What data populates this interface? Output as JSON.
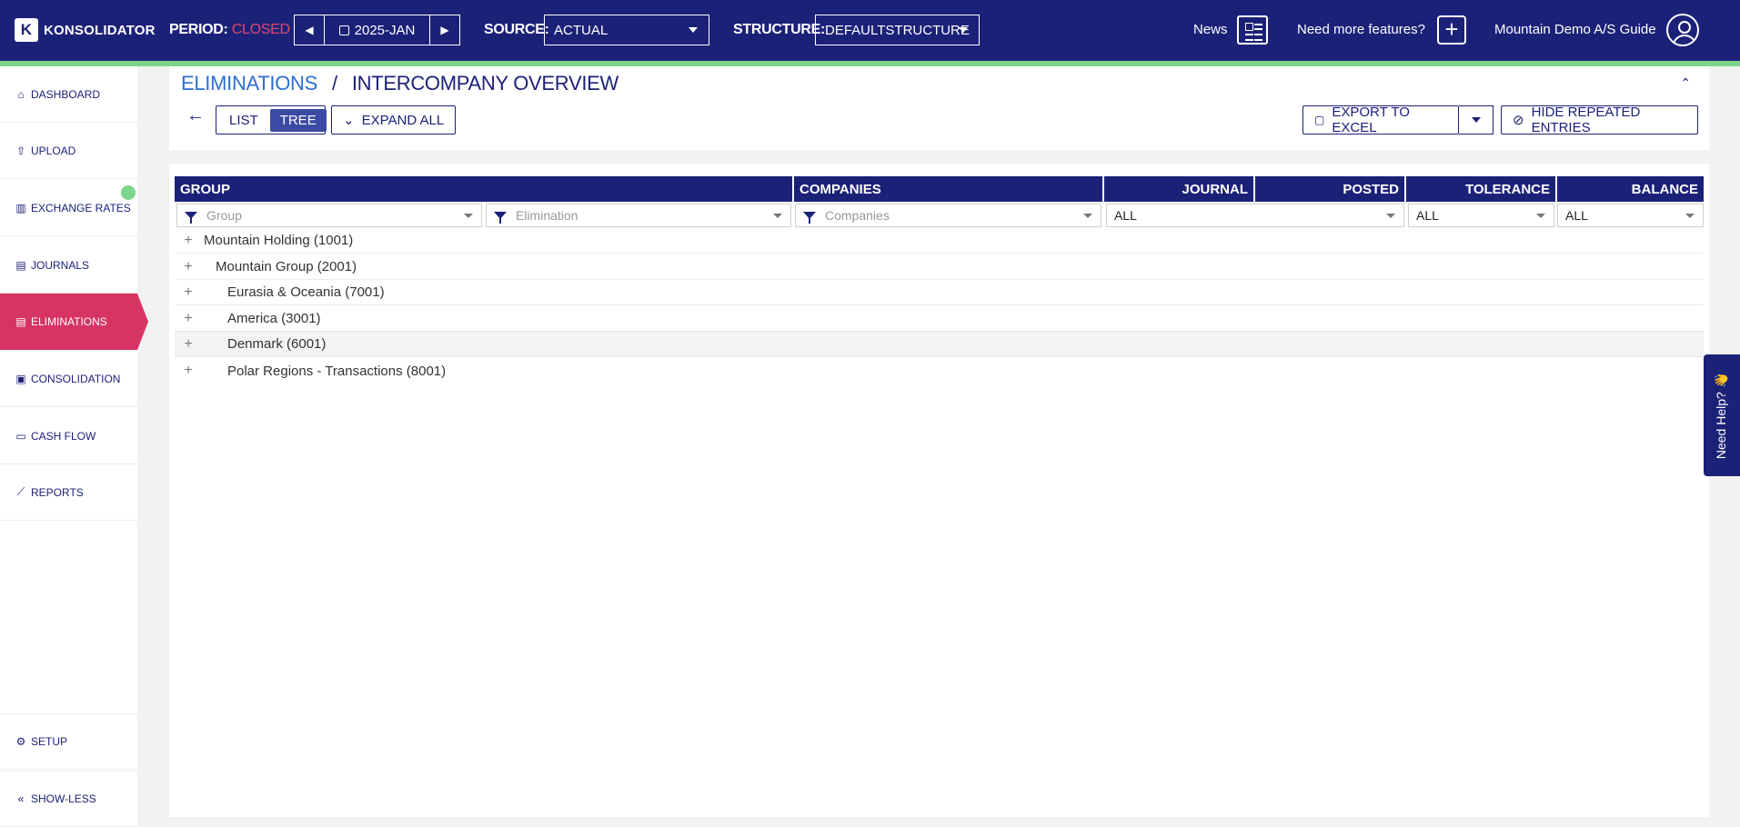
{
  "topbar": {
    "brand": "KONSOLIDATOR",
    "period_label": "PERIOD:",
    "period_status": "CLOSED",
    "period_value": "2025-JAN",
    "source_label": "SOURCE:",
    "source_value": "ACTUAL",
    "structure_label": "STRUCTURE:",
    "structure_value": "DEFAULTSTRUCTURE",
    "news": "News",
    "features": "Need more features?",
    "user": "Mountain Demo A/S Guide"
  },
  "sidebar": {
    "items": [
      {
        "label": "DASHBOARD",
        "icon": "home-icon"
      },
      {
        "label": "UPLOAD",
        "icon": "upload-icon"
      },
      {
        "label": "EXCHANGE RATES",
        "icon": "bar-chart-icon"
      },
      {
        "label": "JOURNALS",
        "icon": "journal-icon"
      },
      {
        "label": "ELIMINATIONS",
        "icon": "eliminations-icon"
      },
      {
        "label": "CONSOLIDATION",
        "icon": "consolidation-icon"
      },
      {
        "label": "CASH FLOW",
        "icon": "cash-icon"
      },
      {
        "label": "REPORTS",
        "icon": "line-chart-icon"
      }
    ],
    "setup": "SETUP",
    "show_less": "SHOW-LESS"
  },
  "header": {
    "breadcrumb_parent": "ELIMINATIONS",
    "breadcrumb_sep": "/",
    "breadcrumb_current": "INTERCOMPANY OVERVIEW",
    "view_list": "LIST",
    "view_tree": "TREE",
    "expand_all": "EXPAND ALL",
    "export": "EXPORT TO EXCEL",
    "hide_repeated": "HIDE REPEATED ENTRIES"
  },
  "grid": {
    "columns": [
      "GROUP",
      "COMPANIES",
      "JOURNAL",
      "POSTED",
      "TOLERANCE",
      "BALANCE"
    ],
    "filters": {
      "group_placeholder": "Group",
      "elimination_placeholder": "Elimination",
      "companies_placeholder": "Companies",
      "journal": "ALL",
      "tolerance": "ALL",
      "balance": "ALL"
    },
    "rows": [
      {
        "label": "Mountain Holding (1001)"
      },
      {
        "label": "Mountain Group (2001)"
      },
      {
        "label": "Eurasia & Oceania (7001)"
      },
      {
        "label": "America (3001)"
      },
      {
        "label": "Denmark (6001)"
      },
      {
        "label": "Polar Regions - Transactions (8001)"
      }
    ]
  },
  "help": "Need Help? 👋",
  "colors": {
    "navy": "#1c2178",
    "accent_green": "#7bd68b",
    "active_pink": "#d63462",
    "link_blue": "#2f6fd0"
  }
}
